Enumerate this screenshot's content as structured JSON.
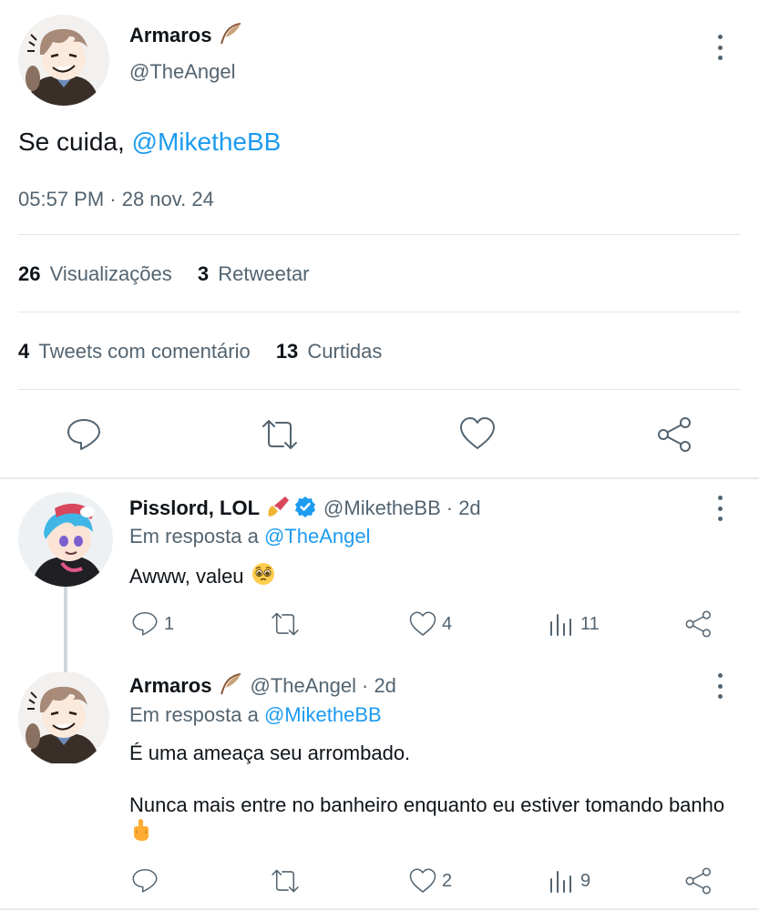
{
  "main_tweet": {
    "author_name": "Armaros",
    "author_handle": "@TheAngel",
    "text_prefix": "Se cuida, ",
    "text_mention": "@MiketheBB",
    "timestamp": "05:57 PM · 28 nov. 24",
    "stats": {
      "views_count": "26",
      "views_label": "Visualizações",
      "retweets_count": "3",
      "retweets_label": "Retweetar",
      "quotes_count": "4",
      "quotes_label": "Tweets com comentário",
      "likes_count": "13",
      "likes_label": "Curtidas"
    }
  },
  "reply1": {
    "author_name": "Pisslord, LOL",
    "author_handle": "@MiketheBB",
    "time": "· 2d",
    "reply_prefix": "Em resposta a ",
    "reply_to": "@TheAngel",
    "text": "Awww, valeu",
    "reply_count": "1",
    "like_count": "4",
    "view_count": "11"
  },
  "reply2": {
    "author_name": "Armaros",
    "author_handle": "@TheAngel",
    "time": "· 2d",
    "reply_prefix": "Em resposta a ",
    "reply_to": "@MiketheBB",
    "text_line1": "É uma ameaça seu arrombado.",
    "text_line2": "Nunca mais entre no banheiro enquanto eu estiver tomando banho",
    "like_count": "2",
    "view_count": "9"
  },
  "colors": {
    "accent": "#1d9bf0",
    "secondary_text": "#536471",
    "divider": "#e3e6e8"
  },
  "icons": [
    "feather-emoji",
    "more-icon",
    "reply-icon",
    "retweet-icon",
    "like-icon",
    "share-icon",
    "views-icon",
    "verified-badge",
    "pleading-emoji",
    "finger-emoji",
    "paintbrush-emoji"
  ]
}
